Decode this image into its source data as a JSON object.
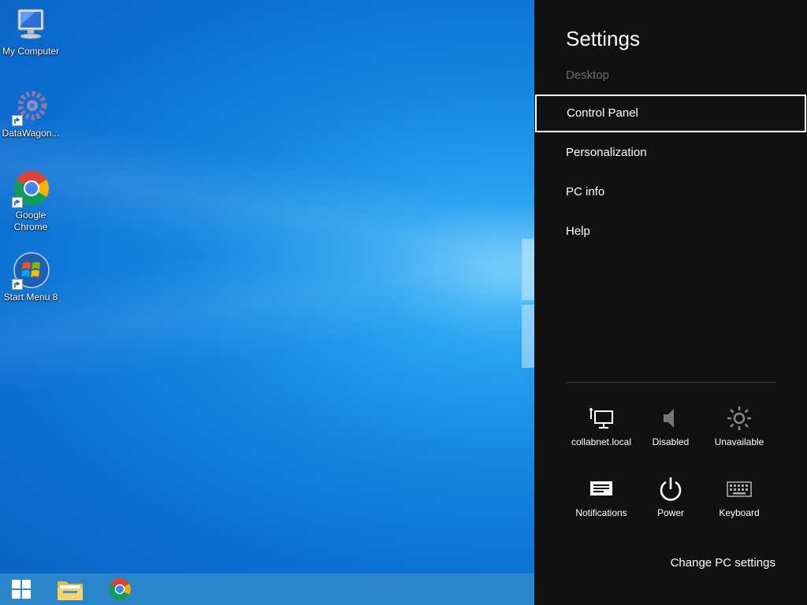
{
  "desktop": {
    "icons": [
      {
        "label": "My Computer",
        "icon": "computer-icon"
      },
      {
        "label": "DataWagon...",
        "icon": "datawagon-icon"
      },
      {
        "label": "Google Chrome",
        "icon": "chrome-icon"
      },
      {
        "label": "Start Menu 8",
        "icon": "start-menu-8-icon"
      }
    ]
  },
  "taskbar": {
    "items": [
      "windows-start-icon",
      "file-explorer-icon",
      "chrome-icon"
    ]
  },
  "settings": {
    "title": "Settings",
    "context": "Desktop",
    "items": [
      {
        "label": "Control Panel",
        "selected": true
      },
      {
        "label": "Personalization",
        "selected": false
      },
      {
        "label": "PC info",
        "selected": false
      },
      {
        "label": "Help",
        "selected": false
      }
    ],
    "quick": [
      {
        "label": "collabnet.local",
        "icon": "network-icon"
      },
      {
        "label": "Disabled",
        "icon": "volume-icon"
      },
      {
        "label": "Unavailable",
        "icon": "brightness-icon"
      },
      {
        "label": "Notifications",
        "icon": "notifications-icon"
      },
      {
        "label": "Power",
        "icon": "power-icon"
      },
      {
        "label": "Keyboard",
        "icon": "keyboard-icon"
      }
    ],
    "change_link": "Change PC settings"
  },
  "colors": {
    "charm_bg": "#111111",
    "accent_selected_border": "#ffffff",
    "muted_text": "#6b6b6b",
    "wallpaper": "#1486e0"
  }
}
